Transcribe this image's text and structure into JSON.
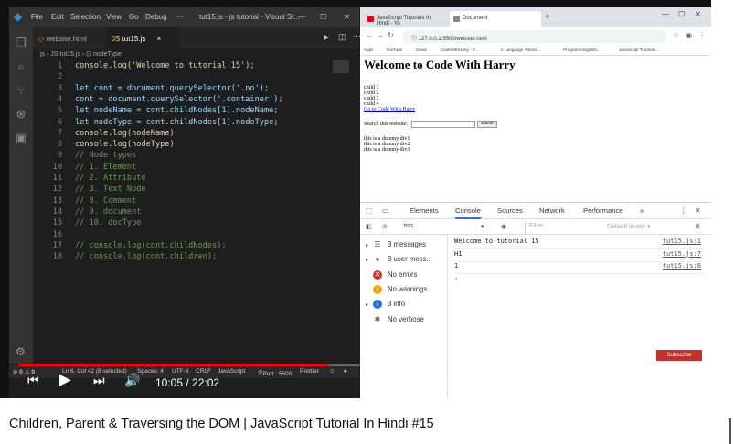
{
  "vscode": {
    "menu": [
      "File",
      "Edit",
      "Selection",
      "View",
      "Go",
      "Debug",
      "···"
    ],
    "window_title": "tut15.js - js tutorial - Visual St...",
    "tabs": [
      {
        "label": "website.html"
      },
      {
        "label": "tut15.js",
        "close": "×"
      }
    ],
    "breadcrumb": "js › JS tut15.js › ⊡ nodeType",
    "lines": [
      {
        "n": "1",
        "t": "console.log('Welcome to tutorial 15');"
      },
      {
        "n": "2",
        "t": ""
      },
      {
        "n": "3",
        "t": "let cont = document.querySelector('.no');"
      },
      {
        "n": "4",
        "t": "cont = document.querySelector('.container');"
      },
      {
        "n": "5",
        "t": "let nodeName = cont.childNodes[1].nodeName;"
      },
      {
        "n": "6",
        "t": "let nodeType = cont.childNodes[1].nodeType;"
      },
      {
        "n": "7",
        "t": "console.log(nodeName)"
      },
      {
        "n": "8",
        "t": "console.log(nodeType)"
      },
      {
        "n": "9",
        "t": "// Node types"
      },
      {
        "n": "10",
        "t": "// 1. Element"
      },
      {
        "n": "11",
        "t": "// 2. Attribute"
      },
      {
        "n": "12",
        "t": "// 3. Text Node"
      },
      {
        "n": "13",
        "t": "// 8. Comment"
      },
      {
        "n": "14",
        "t": "// 9. document"
      },
      {
        "n": "15",
        "t": "// 10. docType"
      },
      {
        "n": "16",
        "t": ""
      },
      {
        "n": "17",
        "t": "// console.log(cont.childNodes);"
      },
      {
        "n": "18",
        "t": "// console.log(cont.children);"
      }
    ],
    "status": {
      "errors": "0",
      "warnings": "0",
      "position": "Ln 6, Col 42 (8 selected)",
      "spaces": "Spaces: 4",
      "encoding": "UTF-8",
      "eol": "CRLF",
      "language": "JavaScript",
      "port": "Port : 5500",
      "formatter": "Prettier"
    }
  },
  "browser": {
    "tabs": [
      {
        "label": "JavaScript Tutorials In Hindi - Yo"
      },
      {
        "label": "Document"
      }
    ],
    "url": "127.0.0.1:5500/website.html",
    "bookmarks": [
      "Apps",
      "YouTube",
      "Gmail",
      "CodeWithHarry - Y...",
      "C Language Tutoria...",
      "ProgrammingWith...",
      "JavaScript Tutorials..."
    ],
    "page": {
      "heading": "Welcome to Code With Harry",
      "children": [
        "child 1",
        "child 2",
        "child 3",
        "child 4"
      ],
      "link": "Go to Code With Harry",
      "search_label": "Search this website:",
      "submit": "submit",
      "dummies": [
        "this is a dummy div1",
        "this is a dummy div2",
        "this is a dummy div3"
      ]
    },
    "devtools": {
      "tabs": [
        "Elements",
        "Console",
        "Sources",
        "Network",
        "Performance",
        "»"
      ],
      "context": "top",
      "filter_placeholder": "Filter",
      "levels": "Default levels ▾",
      "sidebar": [
        {
          "label": "3 messages",
          "icon": "list-icon"
        },
        {
          "label": "3 user mess...",
          "icon": "user-icon"
        },
        {
          "label": "No errors",
          "icon": "error-icon"
        },
        {
          "label": "No warnings",
          "icon": "warning-icon"
        },
        {
          "label": "3 info",
          "icon": "info-icon"
        },
        {
          "label": "No verbose",
          "icon": "bug-icon"
        }
      ],
      "messages": [
        {
          "text": "Welcome to tutorial 15",
          "src": "tut15.js:1"
        },
        {
          "text": "H1",
          "src": "tut15.js:7"
        },
        {
          "text": "1",
          "src": "tut15.js:8"
        }
      ]
    }
  },
  "player": {
    "time": "10:05 / 22:02",
    "progress": 0.457,
    "subscribe": "Subscribe",
    "caption": "Children, Parent & Traversing the DOM | JavaScript Tutorial In Hindi #15"
  }
}
